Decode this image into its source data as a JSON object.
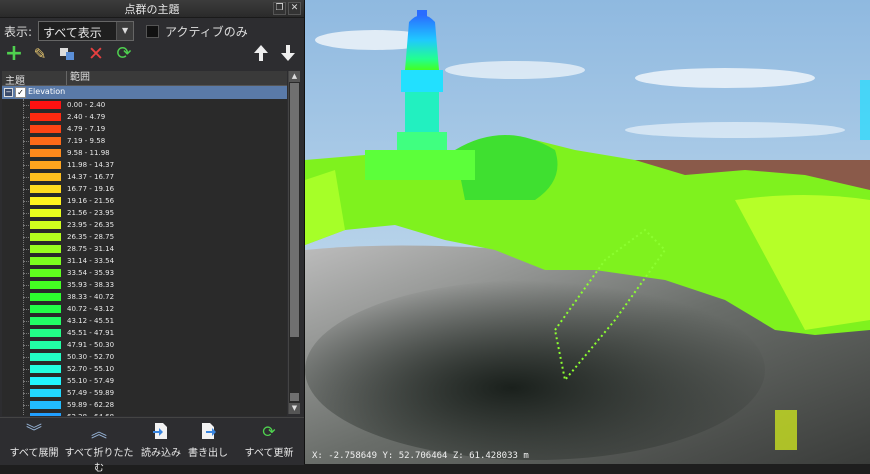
{
  "panel": {
    "title": "点群の主題",
    "float_icon": "float-icon",
    "close_icon": "close-icon",
    "filter_label": "表示:",
    "filter_value": "すべて表示",
    "active_only_label": "アクティブのみ",
    "toolbar": [
      "add-icon",
      "edit-icon",
      "copy-icon",
      "delete-icon",
      "refresh-icon",
      "move-up-icon",
      "move-down-icon"
    ]
  },
  "tree": {
    "col_theme": "主題",
    "col_range": "範囲",
    "root_label": "Elevation",
    "root_expand": "−",
    "root_check": "✓",
    "items": [
      {
        "label": "0.00 - 2.40",
        "color": "#ff1111"
      },
      {
        "label": "2.40 - 4.79",
        "color": "#ff2a10"
      },
      {
        "label": "4.79 - 7.19",
        "color": "#ff4414"
      },
      {
        "label": "7.19 - 9.58",
        "color": "#ff6a18"
      },
      {
        "label": "9.58 - 11.98",
        "color": "#ff8a1c"
      },
      {
        "label": "11.98 - 14.37",
        "color": "#ffa41e"
      },
      {
        "label": "14.37 - 16.77",
        "color": "#ffc01e"
      },
      {
        "label": "16.77 - 19.16",
        "color": "#ffdc1e"
      },
      {
        "label": "19.16 - 21.56",
        "color": "#fff41e"
      },
      {
        "label": "21.56 - 23.95",
        "color": "#e9ff1e"
      },
      {
        "label": "23.95 - 26.35",
        "color": "#d0ff1e"
      },
      {
        "label": "26.35 - 28.75",
        "color": "#b4ff1e"
      },
      {
        "label": "28.75 - 31.14",
        "color": "#98ff1e"
      },
      {
        "label": "31.14 - 33.54",
        "color": "#7cff1e"
      },
      {
        "label": "33.54 - 35.93",
        "color": "#60ff1e"
      },
      {
        "label": "35.93 - 38.33",
        "color": "#44ff22"
      },
      {
        "label": "38.33 - 40.72",
        "color": "#2cff2e"
      },
      {
        "label": "40.72 - 43.12",
        "color": "#22ff48"
      },
      {
        "label": "43.12 - 45.51",
        "color": "#22ff66"
      },
      {
        "label": "45.51 - 47.91",
        "color": "#22ff86"
      },
      {
        "label": "47.91 - 50.30",
        "color": "#22ffa4"
      },
      {
        "label": "50.30 - 52.70",
        "color": "#22ffc4"
      },
      {
        "label": "52.70 - 55.10",
        "color": "#22ffe0"
      },
      {
        "label": "55.10 - 57.49",
        "color": "#22f4ff"
      },
      {
        "label": "57.49 - 59.89",
        "color": "#22d8ff"
      },
      {
        "label": "59.89 - 62.28",
        "color": "#22bcff"
      },
      {
        "label": "62.28 - 64.68",
        "color": "#22a0ff"
      }
    ]
  },
  "bottom": {
    "expand_all": "すべて展開",
    "collapse_all": "すべて折りたたむ",
    "import": "読み込み",
    "export": "書き出し",
    "update_all": "すべて更新"
  },
  "viewport": {
    "coords": "X: -2.758649 Y: 52.706464 Z: 61.428033 m"
  }
}
